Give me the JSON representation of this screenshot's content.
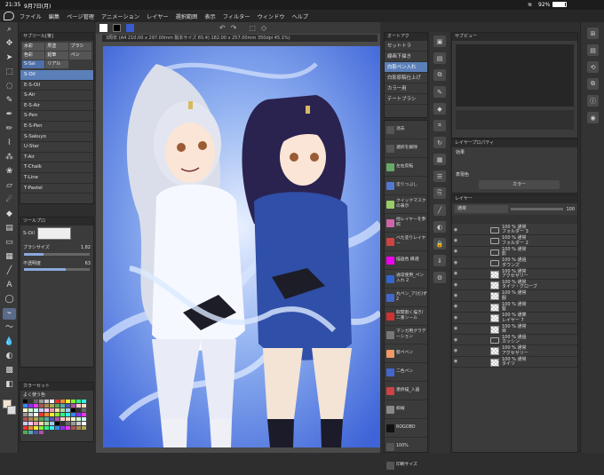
{
  "status": {
    "time": "21:35",
    "date": "9月7日(月)",
    "battery": "92%"
  },
  "menu": [
    "ファイル",
    "編集",
    "ページ管理",
    "アニメーション",
    "レイヤー",
    "選択範囲",
    "表示",
    "フィルター",
    "ウィンドウ",
    "ヘルプ"
  ],
  "subtool": {
    "header": "サブツール[筆]",
    "chips": [
      "水彩",
      "厚塗",
      "ブラシ",
      "色彩",
      "鉛筆",
      "ペン",
      "S-Sai",
      "リアル"
    ],
    "brushes": [
      "S-Oil",
      "E-S-Oil",
      "S-Air",
      "E-S-Air",
      "S-Pen",
      "E-S-Pen",
      "S-Sakuyo",
      "U-Star",
      "T-Air",
      "T-Chalk",
      "T-Line",
      "T-Pastel"
    ],
    "selected": "S-Oil"
  },
  "toolprop": {
    "header": "ツールプロ",
    "brush": "S-Oil",
    "size_label": "ブラシサイズ",
    "size_value": "1.82",
    "opacity_label": "不透明度",
    "opacity_value": "63"
  },
  "colorset": {
    "header": "カラーセット",
    "name": "よく使う色"
  },
  "doc": {
    "tab": "3周年 (A4 210.00 x 297.00mm 製本サイズ 65.4) 182.00 x 257.00mm 350dpi 45.1%)"
  },
  "autoaction": {
    "header": "オートアク",
    "items": [
      "セットトラ",
      "線画下描き",
      "白影ペン入れ",
      "白影原稿仕上げ",
      "カラー用",
      "テートブラシ"
    ],
    "selected": "白影ペン入れ"
  },
  "midlist": {
    "items": [
      {
        "label": "消去"
      },
      {
        "label": "選択を解除"
      },
      {
        "label": "左右反転"
      },
      {
        "label": "塗りつぶし"
      },
      {
        "label": "クイックマスクの表示"
      },
      {
        "label": "他レイヤーを参照"
      },
      {
        "label": "べた塗りレイヤー"
      },
      {
        "label": "描画色 縁選"
      },
      {
        "label": "通常使用_ペン入れ 2"
      },
      {
        "label": "丸ペン_ア(だ)ず 2"
      },
      {
        "label": "取間割く描き/二重ンール"
      },
      {
        "label": "マンガ用グラデーション"
      },
      {
        "label": "髪ペベン"
      },
      {
        "label": "二色ペン"
      },
      {
        "label": "墨掛描_入画"
      },
      {
        "label": "斜線"
      },
      {
        "label": "ROGOBO"
      },
      {
        "label": "100%"
      },
      {
        "label": "印刷サイズ"
      }
    ]
  },
  "subview": {
    "header": "サブビュー"
  },
  "layerprop": {
    "header": "レイヤープロパティ",
    "effect": "効果",
    "expression_label": "表現色",
    "expression_value": "カラー"
  },
  "layers": {
    "header": "レイヤー",
    "blend": "通常",
    "opacity": "100",
    "rows": [
      {
        "mode": "100 % 通常",
        "name": "フォルダー 3",
        "type": "folder"
      },
      {
        "mode": "100 % 通常",
        "name": "フォルダー 2",
        "type": "folder"
      },
      {
        "mode": "100 % 通常",
        "name": "影",
        "type": "folder"
      },
      {
        "mode": "100 % 通過",
        "name": "ダウンズ",
        "type": "folder"
      },
      {
        "mode": "100 % 通常",
        "name": "アクセサリー",
        "type": "layer"
      },
      {
        "mode": "100 % 通常",
        "name": "タイツ・グローブ",
        "type": "layer"
      },
      {
        "mode": "100 % 通常",
        "name": "服",
        "type": "layer"
      },
      {
        "mode": "100 % 通常",
        "name": "髪",
        "type": "layer"
      },
      {
        "mode": "100 % 通算",
        "name": "レイヤー 7",
        "type": "layer"
      },
      {
        "mode": "100 % 通常",
        "name": "目",
        "type": "layer"
      },
      {
        "mode": "100 % 通過",
        "name": "カッシン",
        "type": "folder"
      },
      {
        "mode": "100 % 通常",
        "name": "アクセサリー",
        "type": "layer"
      },
      {
        "mode": "100 % 通常",
        "name": "タイツ",
        "type": "layer"
      }
    ]
  },
  "colors": {
    "accent": "#5b7fb8",
    "panel": "#3b3b3b"
  }
}
